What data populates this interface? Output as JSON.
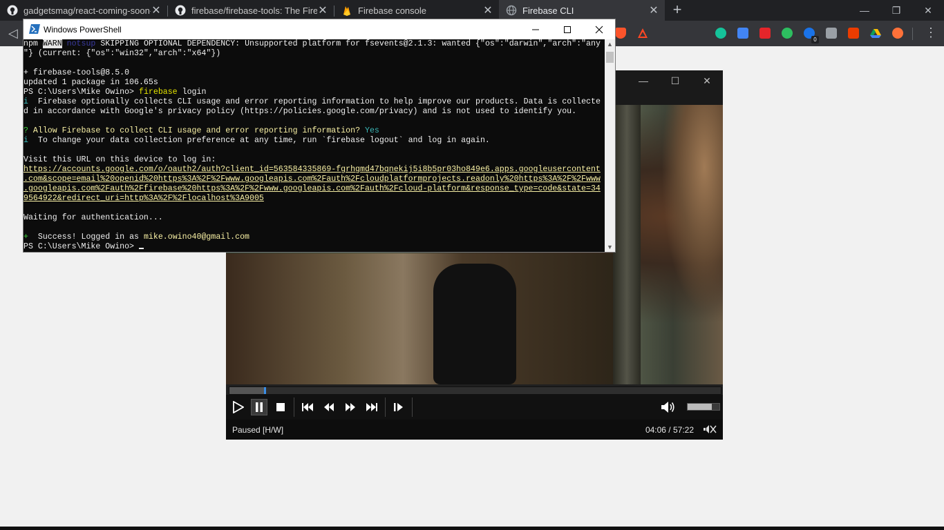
{
  "browser": {
    "tabs": [
      {
        "title": "gadgetsmag/react-coming-soon-t",
        "icon": "github-icon",
        "active": false
      },
      {
        "title": "firebase/firebase-tools: The Fireba",
        "icon": "github-icon",
        "active": false
      },
      {
        "title": "Firebase console",
        "icon": "firebase-icon",
        "active": false
      },
      {
        "title": "Firebase CLI",
        "icon": "globe-icon",
        "active": true
      }
    ],
    "new_tab": "+",
    "window_controls": {
      "minimize": "—",
      "restore": "❐",
      "close": "✕"
    },
    "back": "◁",
    "menu": "⋮",
    "extensions": [
      {
        "icon": "brave-shield-icon",
        "color": "#fb542b"
      },
      {
        "icon": "brave-rewards-icon",
        "color": "#ff4724"
      },
      {
        "icon": "grammarly-icon",
        "color": "#15c39a"
      },
      {
        "icon": "google-translate-icon",
        "color": "#4285f4"
      },
      {
        "icon": "pdf-icon",
        "color": "#e5252a"
      },
      {
        "icon": "evernote-icon",
        "color": "#2dbe60"
      },
      {
        "icon": "badge-extension-icon",
        "color": "#1a73e8",
        "badge": "0"
      },
      {
        "icon": "reader-icon",
        "color": "#9aa0a6"
      },
      {
        "icon": "office-icon",
        "color": "#eb3c00"
      },
      {
        "icon": "google-drive-icon",
        "color": "#fbbc04"
      },
      {
        "icon": "fox-extension-icon",
        "color": "#ff7139"
      }
    ]
  },
  "player": {
    "window_controls": {
      "minimize": "—",
      "maximize": "☐",
      "close": "✕"
    },
    "progress": 0.07,
    "volume": 0.75,
    "status": "Paused [H/W]",
    "time": "04:06 / 57:22",
    "controls": [
      "play-icon",
      "pause-icon",
      "stop-icon",
      "skip-back-icon",
      "rewind-icon",
      "fast-forward-icon",
      "skip-forward-icon",
      "frame-step-icon",
      "volume-icon"
    ]
  },
  "powershell": {
    "title": "Windows PowerShell",
    "window_controls": {
      "minimize": "—",
      "maximize": "☐",
      "close": "✕"
    },
    "lines": {
      "l1a": "npm ",
      "l1warn": "WARN",
      "l1b": " notsup",
      "l1c": " SKIPPING OPTIONAL DEPENDENCY: Unsupported platform for fsevents@2.1.3: wanted {\"os\":\"darwin\",\"arch\":\"any",
      "l2": "\"} (current: {\"os\":\"win32\",\"arch\":\"x64\"})",
      "l3": "",
      "l4": "+ firebase-tools@8.5.0",
      "l5": "updated 1 package in 106.65s",
      "l6prompt": "PS C:\\Users\\Mike Owino> ",
      "l6cmd": "firebase",
      "l6arg": " login",
      "l7i": "i",
      "l7": "  Firebase optionally collects CLI usage and error reporting information to help improve our products. Data is collecte",
      "l8": "d in accordance with Google's privacy policy (https://policies.google.com/privacy) and is not used to identify you.",
      "l9": "",
      "l10q": "?",
      "l10": " Allow Firebase to collect CLI usage and error reporting information?",
      "l10ans": " Yes",
      "l11i": "i",
      "l11": "  To change your data collection preference at any time, run `firebase logout` and log in again.",
      "l12": "",
      "l13": "Visit this URL on this device to log in:",
      "url1": "https://accounts.google.com/o/oauth2/auth?client_id=563584335869-fgrhgmd47bqnekij5i8b5pr03ho849e6.apps.googleusercontent",
      "url2": ".com&scope=email%20openid%20https%3A%2F%2Fwww.googleapis.com%2Fauth%2Fcloudplatformprojects.readonly%20https%3A%2F%2Fwww",
      "url3": ".googleapis.com%2Fauth%2Ffirebase%20https%3A%2F%2Fwww.googleapis.com%2Fauth%2Fcloud-platform&response_type=code&state=34",
      "url4": "9564922&redirect_uri=http%3A%2F%2Flocalhost%3A9005",
      "l18": "",
      "l19": "Waiting for authentication...",
      "l20": "",
      "l21plus": "+",
      "l21": "  Success! Logged in as ",
      "l21email": "mike.owino40@gmail.com",
      "l22prompt": "PS C:\\Users\\Mike Owino> "
    }
  }
}
